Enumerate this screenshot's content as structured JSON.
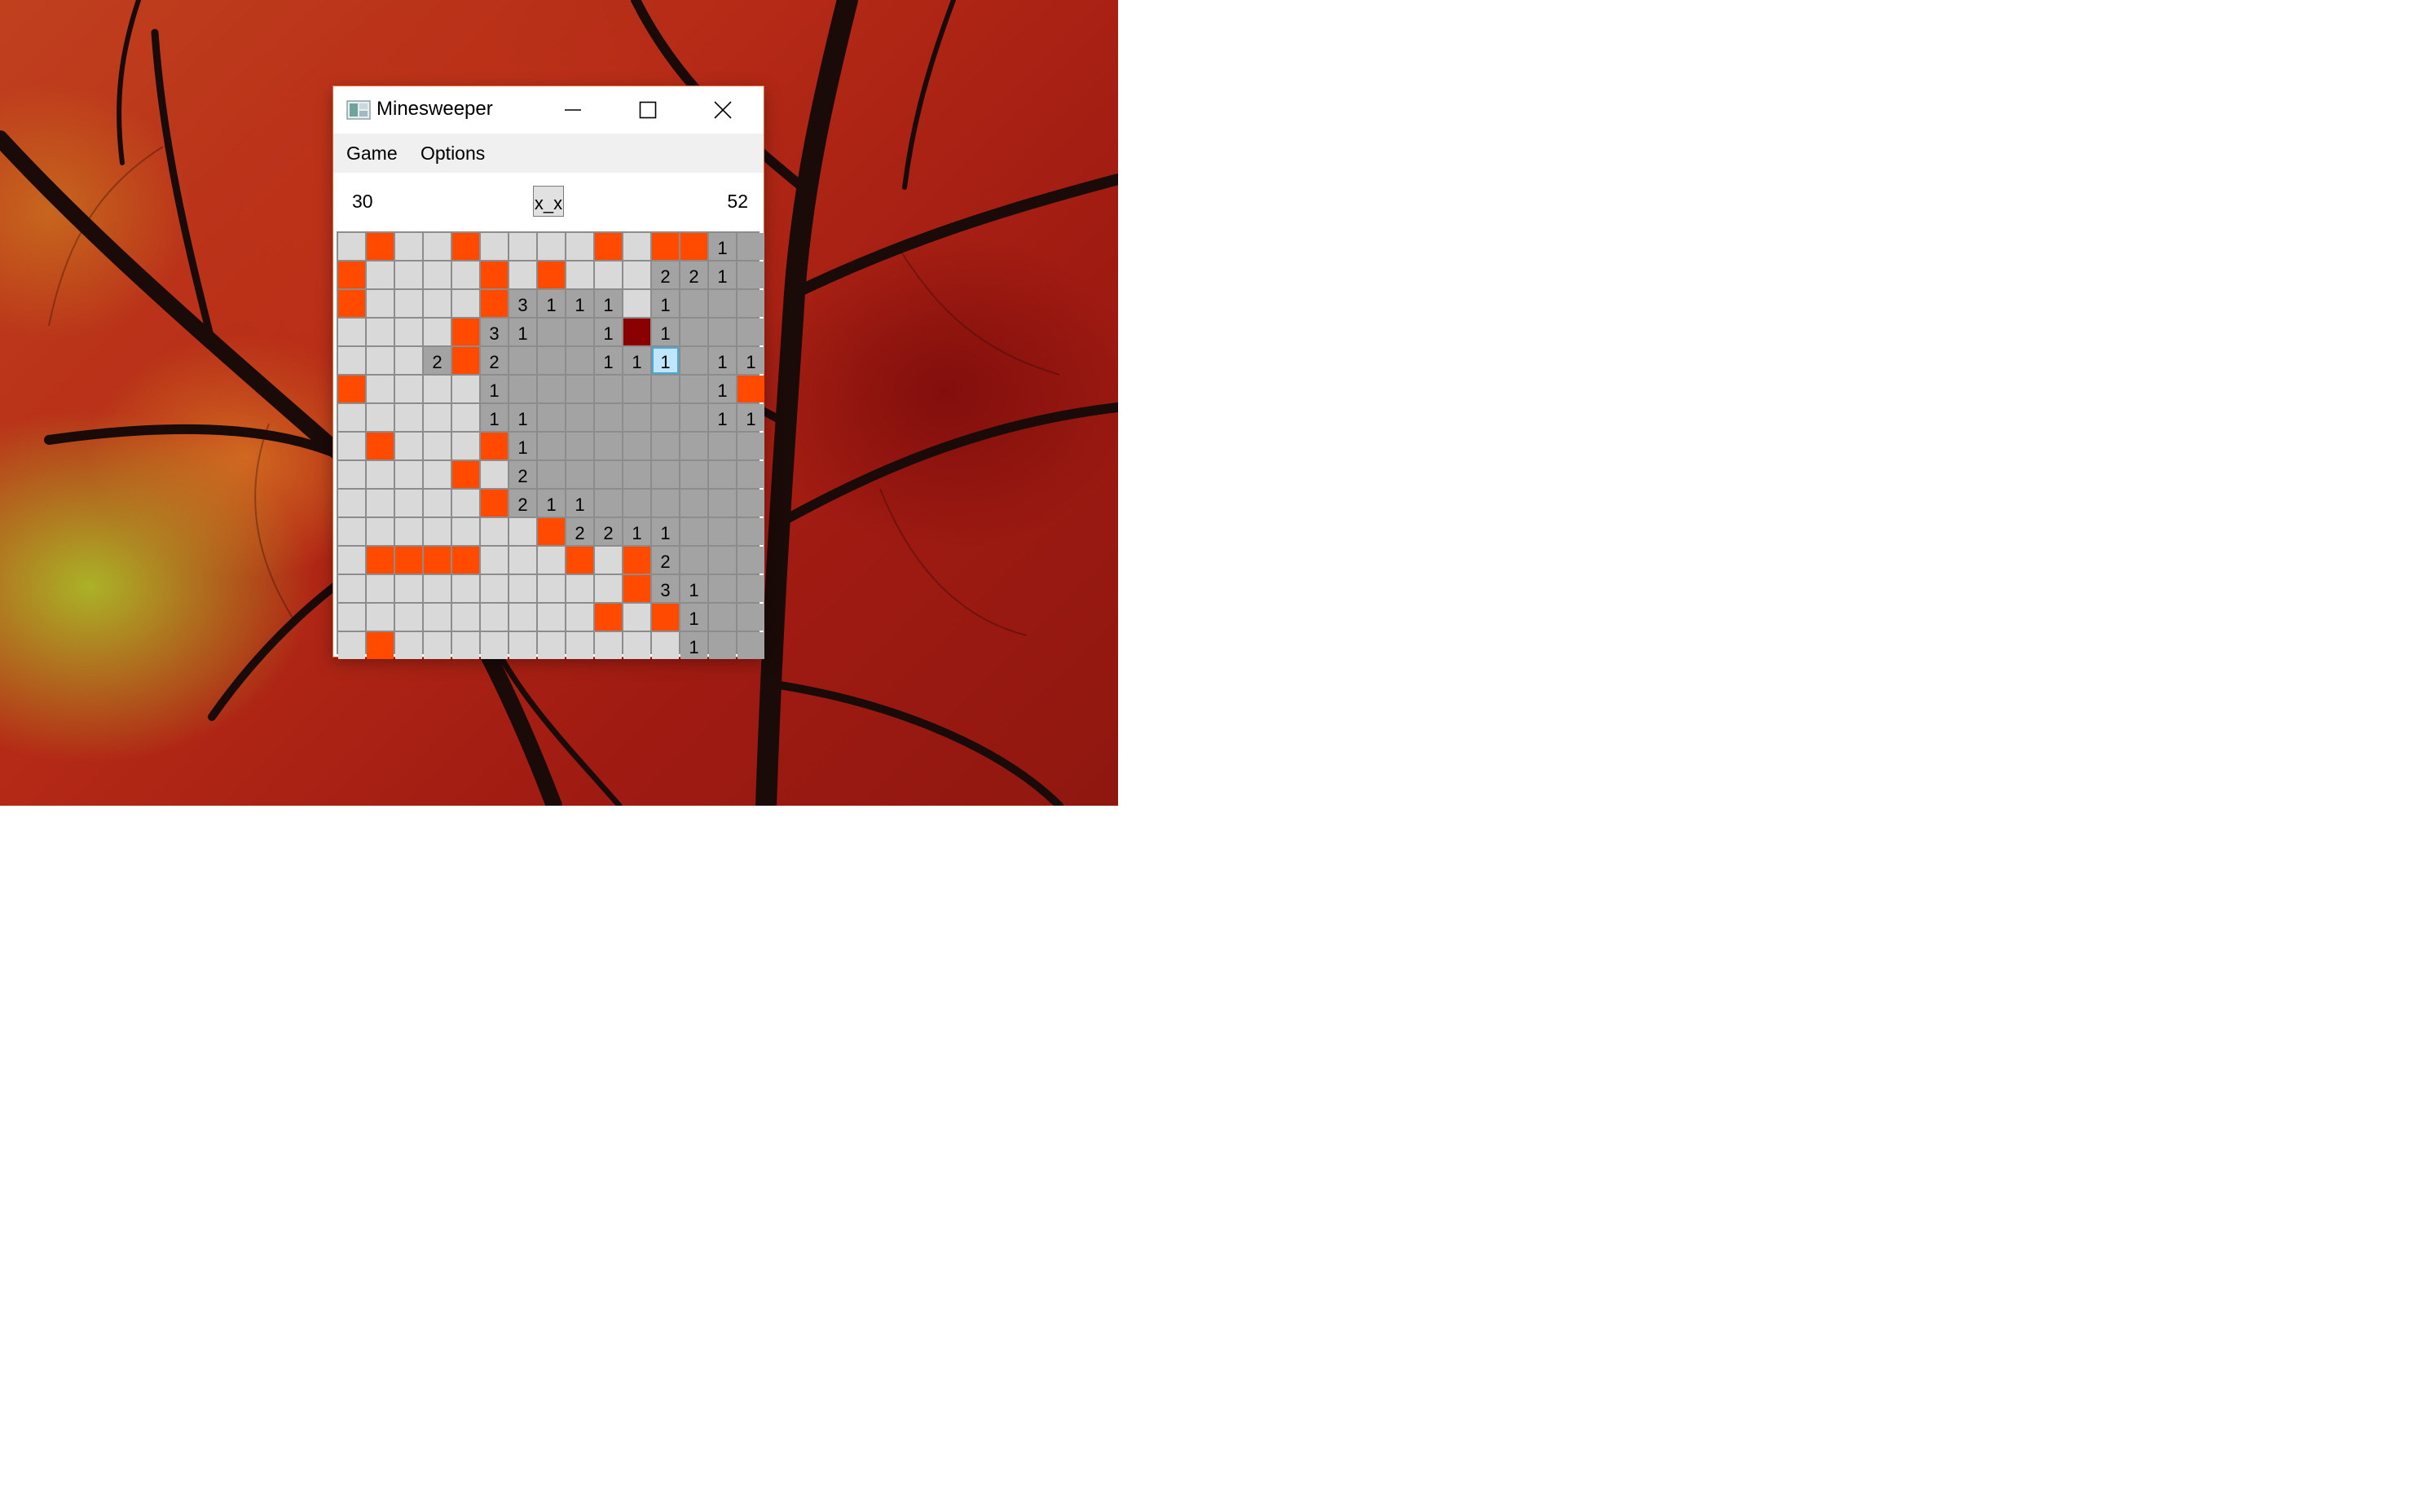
{
  "window": {
    "title": "Minesweeper",
    "controls": {
      "minimize": "minimize-icon",
      "maximize": "maximize-icon",
      "close": "close-icon"
    }
  },
  "menu": {
    "game": "Game",
    "options": "Options"
  },
  "status": {
    "mines_left": "30",
    "face": "x_x",
    "time": "52"
  },
  "colors": {
    "unrevealed": "#d9d9d9",
    "mine": "#ff4a00",
    "exploded": "#8b0000",
    "revealed": "#a3a3a3",
    "selected": "#bfe6fb"
  },
  "board": {
    "rows": 15,
    "cols": 15,
    "legend": {
      "U": "unrevealed",
      "M": "mine",
      "X": "exploded-mine",
      "R": "revealed",
      "S": "selected-revealed"
    },
    "cells": [
      [
        "U",
        "M",
        "U",
        "U",
        "M",
        "U",
        "U",
        "U",
        "U",
        "M",
        "U",
        "M",
        "M",
        "1",
        "R"
      ],
      [
        "M",
        "U",
        "U",
        "U",
        "U",
        "M",
        "U",
        "M",
        "U",
        "U",
        "U",
        "2",
        "2",
        "1",
        "R"
      ],
      [
        "M",
        "U",
        "U",
        "U",
        "U",
        "M",
        "3",
        "1",
        "1",
        "1",
        "U",
        "1",
        "R",
        "R",
        "R"
      ],
      [
        "U",
        "U",
        "U",
        "U",
        "M",
        "3",
        "1",
        "R",
        "R",
        "1",
        "X",
        "1",
        "R",
        "R",
        "R"
      ],
      [
        "U",
        "U",
        "U",
        "2",
        "M",
        "2",
        "R",
        "R",
        "R",
        "1",
        "1",
        "S1",
        "R",
        "1",
        "1"
      ],
      [
        "M",
        "U",
        "U",
        "U",
        "U",
        "1",
        "R",
        "R",
        "R",
        "R",
        "R",
        "R",
        "R",
        "1",
        "M"
      ],
      [
        "U",
        "U",
        "U",
        "U",
        "U",
        "1",
        "1",
        "R",
        "R",
        "R",
        "R",
        "R",
        "R",
        "1",
        "1"
      ],
      [
        "U",
        "M",
        "U",
        "U",
        "U",
        "M",
        "1",
        "R",
        "R",
        "R",
        "R",
        "R",
        "R",
        "R",
        "R"
      ],
      [
        "U",
        "U",
        "U",
        "U",
        "M",
        "U",
        "2",
        "R",
        "R",
        "R",
        "R",
        "R",
        "R",
        "R",
        "R"
      ],
      [
        "U",
        "U",
        "U",
        "U",
        "U",
        "M",
        "2",
        "1",
        "1",
        "R",
        "R",
        "R",
        "R",
        "R",
        "R"
      ],
      [
        "U",
        "U",
        "U",
        "U",
        "U",
        "U",
        "U",
        "M",
        "2",
        "2",
        "1",
        "1",
        "R",
        "R",
        "R"
      ],
      [
        "U",
        "M",
        "M",
        "M",
        "M",
        "U",
        "U",
        "U",
        "M",
        "U",
        "M",
        "2",
        "R",
        "R",
        "R"
      ],
      [
        "U",
        "U",
        "U",
        "U",
        "U",
        "U",
        "U",
        "U",
        "U",
        "U",
        "M",
        "3",
        "1",
        "R",
        "R"
      ],
      [
        "U",
        "U",
        "U",
        "U",
        "U",
        "U",
        "U",
        "U",
        "U",
        "M",
        "U",
        "M",
        "1",
        "R",
        "R"
      ],
      [
        "U",
        "M",
        "U",
        "U",
        "U",
        "U",
        "U",
        "U",
        "U",
        "U",
        "U",
        "U",
        "1",
        "R",
        "R"
      ]
    ]
  }
}
